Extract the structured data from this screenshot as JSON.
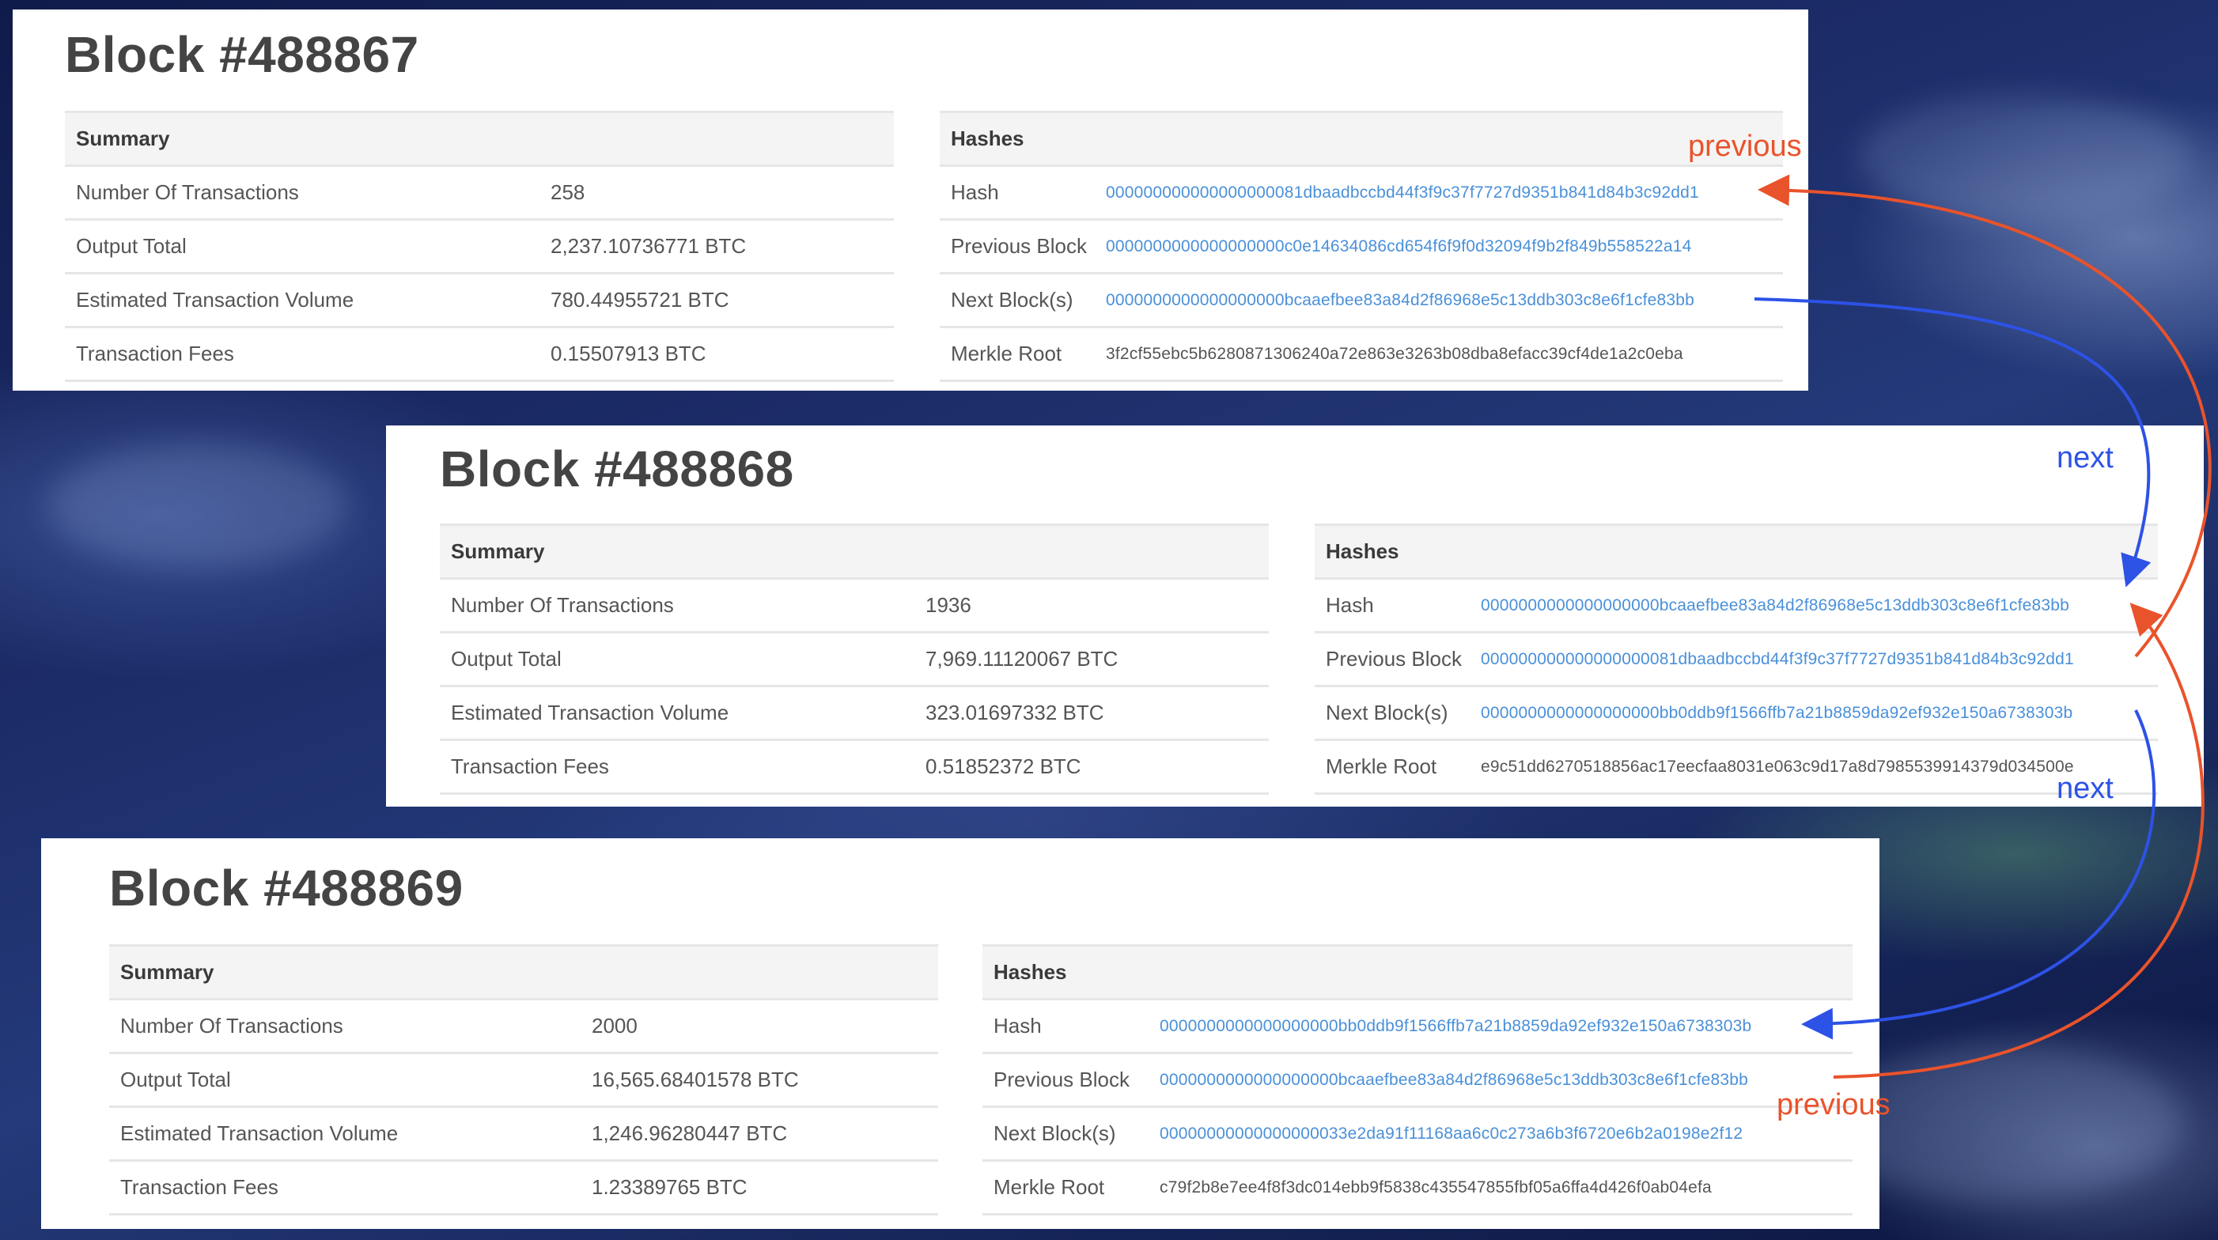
{
  "blocks": [
    {
      "title": "Block #488867",
      "summary": {
        "heading": "Summary",
        "rows": [
          {
            "label": "Number Of Transactions",
            "value": "258"
          },
          {
            "label": "Output Total",
            "value": "2,237.10736771 BTC"
          },
          {
            "label": "Estimated Transaction Volume",
            "value": "780.44955721 BTC"
          },
          {
            "label": "Transaction Fees",
            "value": "0.15507913 BTC"
          }
        ]
      },
      "hashes": {
        "heading": "Hashes",
        "rows": [
          {
            "label": "Hash",
            "value": "000000000000000000081dbaadbccbd44f3f9c37f7727d9351b841d84b3c92dd1"
          },
          {
            "label": "Previous Block",
            "value": "0000000000000000000c0e14634086cd654f6f9f0d32094f9b2f849b558522a14"
          },
          {
            "label": "Next Block(s)",
            "value": "0000000000000000000bcaaefbee83a84d2f86968e5c13ddb303c8e6f1cfe83bb"
          },
          {
            "label": "Merkle Root",
            "value": "3f2cf55ebc5b6280871306240a72e863e3263b08dba8efacc39cf4de1a2c0eba"
          }
        ]
      }
    },
    {
      "title": "Block #488868",
      "summary": {
        "heading": "Summary",
        "rows": [
          {
            "label": "Number Of Transactions",
            "value": "1936"
          },
          {
            "label": "Output Total",
            "value": "7,969.11120067 BTC"
          },
          {
            "label": "Estimated Transaction Volume",
            "value": "323.01697332 BTC"
          },
          {
            "label": "Transaction Fees",
            "value": "0.51852372 BTC"
          }
        ]
      },
      "hashes": {
        "heading": "Hashes",
        "rows": [
          {
            "label": "Hash",
            "value": "0000000000000000000bcaaefbee83a84d2f86968e5c13ddb303c8e6f1cfe83bb"
          },
          {
            "label": "Previous Block",
            "value": "000000000000000000081dbaadbccbd44f3f9c37f7727d9351b841d84b3c92dd1"
          },
          {
            "label": "Next Block(s)",
            "value": "0000000000000000000bb0ddb9f1566ffb7a21b8859da92ef932e150a6738303b"
          },
          {
            "label": "Merkle Root",
            "value": "e9c51dd6270518856ac17eecfaa8031e063c9d17a8d7985539914379d034500e"
          }
        ]
      }
    },
    {
      "title": "Block #488869",
      "summary": {
        "heading": "Summary",
        "rows": [
          {
            "label": "Number Of Transactions",
            "value": "2000"
          },
          {
            "label": "Output Total",
            "value": "16,565.68401578 BTC"
          },
          {
            "label": "Estimated Transaction Volume",
            "value": "1,246.96280447 BTC"
          },
          {
            "label": "Transaction Fees",
            "value": "1.23389765 BTC"
          }
        ]
      },
      "hashes": {
        "heading": "Hashes",
        "rows": [
          {
            "label": "Hash",
            "value": "0000000000000000000bb0ddb9f1566ffb7a21b8859da92ef932e150a6738303b"
          },
          {
            "label": "Previous Block",
            "value": "0000000000000000000bcaaefbee83a84d2f86968e5c13ddb303c8e6f1cfe83bb"
          },
          {
            "label": "Next Block(s)",
            "value": "00000000000000000033e2da91f11168aa6c0c273a6b3f6720e6b2a0198e2f12"
          },
          {
            "label": "Merkle Root",
            "value": "c79f2b8e7ee4f8f3dc014ebb9f5838c435547855fbf05a6ffa4d426f0ab04efa"
          }
        ]
      }
    }
  ],
  "annotations": {
    "previous_top": "previous",
    "next_top": "next",
    "next_bottom": "next",
    "previous_bottom": "previous"
  },
  "colors": {
    "previous_arrow": "#e9532b",
    "next_arrow": "#2d52e6",
    "hash_link": "#4a90d9"
  }
}
